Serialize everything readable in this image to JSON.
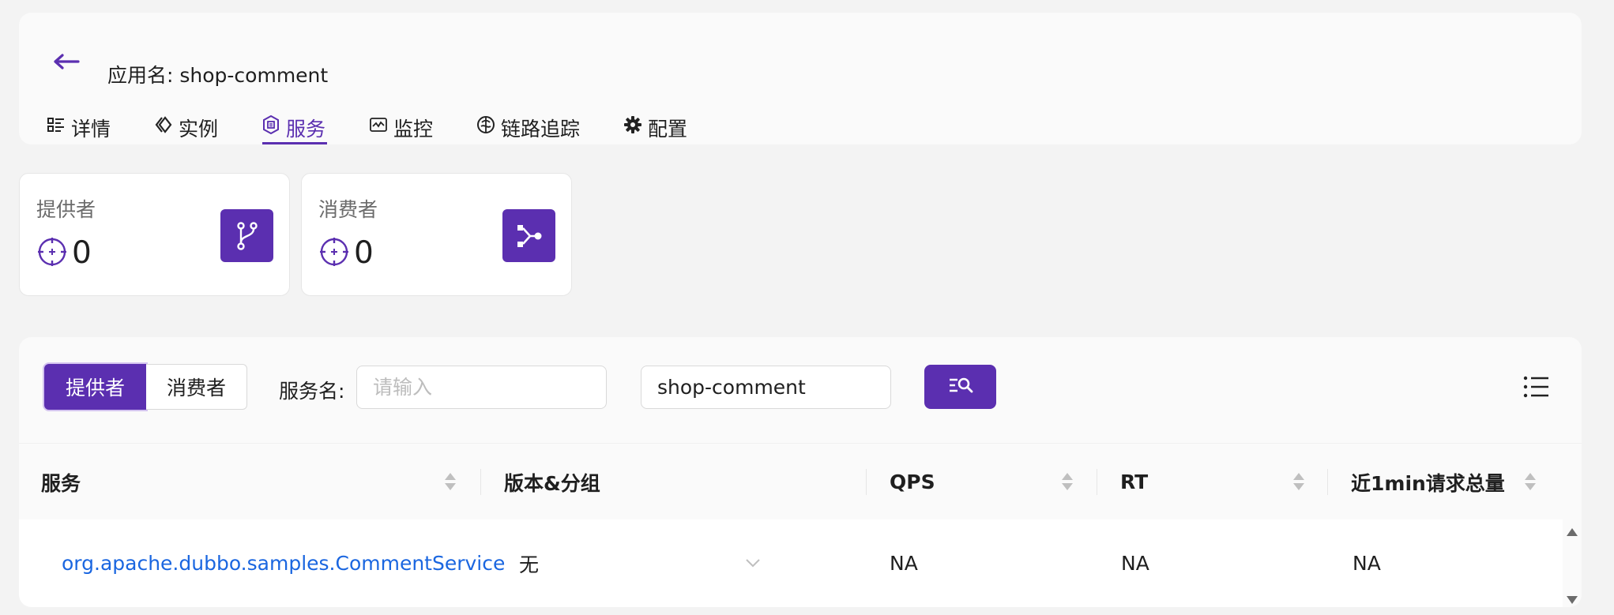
{
  "header": {
    "app_title": "应用名: shop-comment",
    "tabs": [
      {
        "label": "详情",
        "icon": "list-detail-icon",
        "active": false
      },
      {
        "label": "实例",
        "icon": "diamond-code-icon",
        "active": false
      },
      {
        "label": "服务",
        "icon": "hexagon-service-icon",
        "active": true
      },
      {
        "label": "监控",
        "icon": "monitor-chart-icon",
        "active": false
      },
      {
        "label": "链路追踪",
        "icon": "trace-icon",
        "active": false
      },
      {
        "label": "配置",
        "icon": "gear-icon",
        "active": false
      }
    ]
  },
  "stats": [
    {
      "label": "提供者",
      "value": "0",
      "icon": "branch-icon"
    },
    {
      "label": "消费者",
      "value": "0",
      "icon": "merge-icon"
    }
  ],
  "filters": {
    "segments": [
      "提供者",
      "消费者"
    ],
    "active_segment": "提供者",
    "service_name_label": "服务名:",
    "service_name_placeholder": "请输入",
    "app_value": "shop-comment"
  },
  "table": {
    "columns": [
      "服务",
      "版本&分组",
      "QPS",
      "RT",
      "近1min请求总量"
    ],
    "rows": [
      {
        "service": "org.apache.dubbo.samples.CommentService",
        "version_group": "无",
        "qps": "NA",
        "rt": "NA",
        "total": "NA"
      }
    ]
  },
  "colors": {
    "accent": "#5b2fb0",
    "link": "#1a66e0",
    "background": "#f3f3f3"
  }
}
